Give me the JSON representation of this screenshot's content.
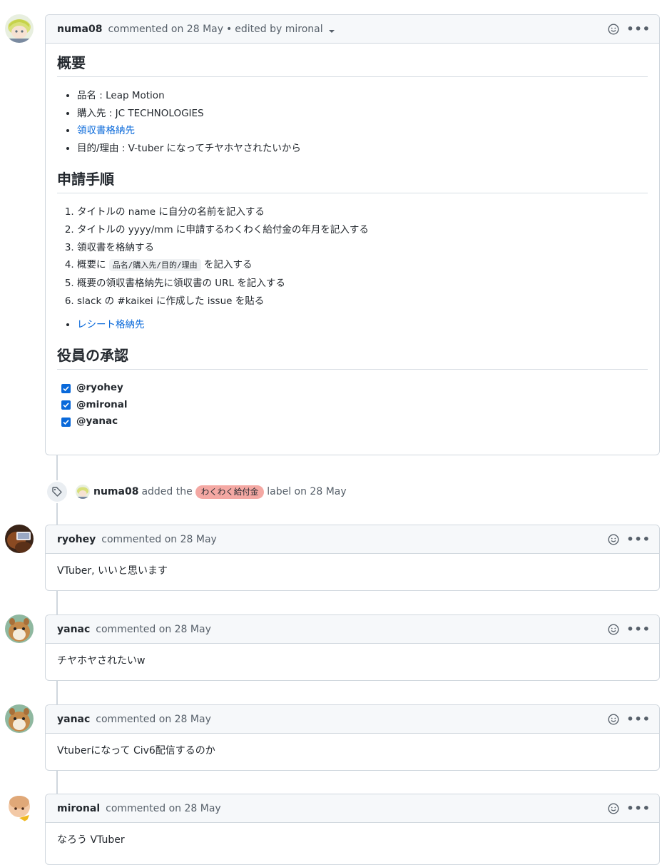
{
  "first_comment": {
    "author": "numa08",
    "action": "commented on 28 May",
    "separator": "•",
    "edited": "edited by mironal",
    "overview": {
      "heading": "概要",
      "items": [
        {
          "text": "品名 : Leap Motion"
        },
        {
          "text": "購入先 : JC TECHNOLOGIES"
        },
        {
          "text": "領収書格納先"
        },
        {
          "text": "目的/理由 : V-tuber になってチヤホヤされたいから"
        }
      ]
    },
    "procedure": {
      "heading": "申請手順",
      "steps": [
        "タイトルの name に自分の名前を記入する",
        "タイトルの yyyy/mm に申請するわくわく給付金の年月を記入する",
        "領収書を格納する",
        {
          "before": "概要に ",
          "code": "品名/購入先/目的/理由",
          "after": " を記入する"
        },
        "概要の領収書格納先に領収書の URL を記入する",
        "slack の #kaikei に作成した issue を貼る"
      ],
      "link_item": "レシート格納先"
    },
    "approval": {
      "heading": "役員の承認",
      "checked": [
        "@ryohey",
        "@mironal",
        "@yanac"
      ]
    }
  },
  "label_event": {
    "author": "numa08",
    "before": "added the",
    "label": "わくわく給付金",
    "label_color": "#f4a8a3",
    "after": "label on 28 May"
  },
  "comments": [
    {
      "author": "ryohey",
      "action": "commented on 28 May",
      "body": "VTuber, いいと思います"
    },
    {
      "author": "yanac",
      "action": "commented on 28 May",
      "body": "チヤホヤされたいw"
    },
    {
      "author": "yanac",
      "action": "commented on 28 May",
      "body": "Vtuberになって Civ6配信するのか"
    },
    {
      "author": "mironal",
      "action": "commented on 28 May",
      "body": "なろう VTuber"
    }
  ],
  "icons": {
    "reaction": "smiley-icon",
    "more": "kebab-horizontal-icon",
    "tag": "tag-icon",
    "checkbox": "checkbox-checked-icon"
  },
  "colors": {
    "link": "#0969da",
    "header_bg": "#f6f8fa",
    "border": "#d0d7de"
  }
}
